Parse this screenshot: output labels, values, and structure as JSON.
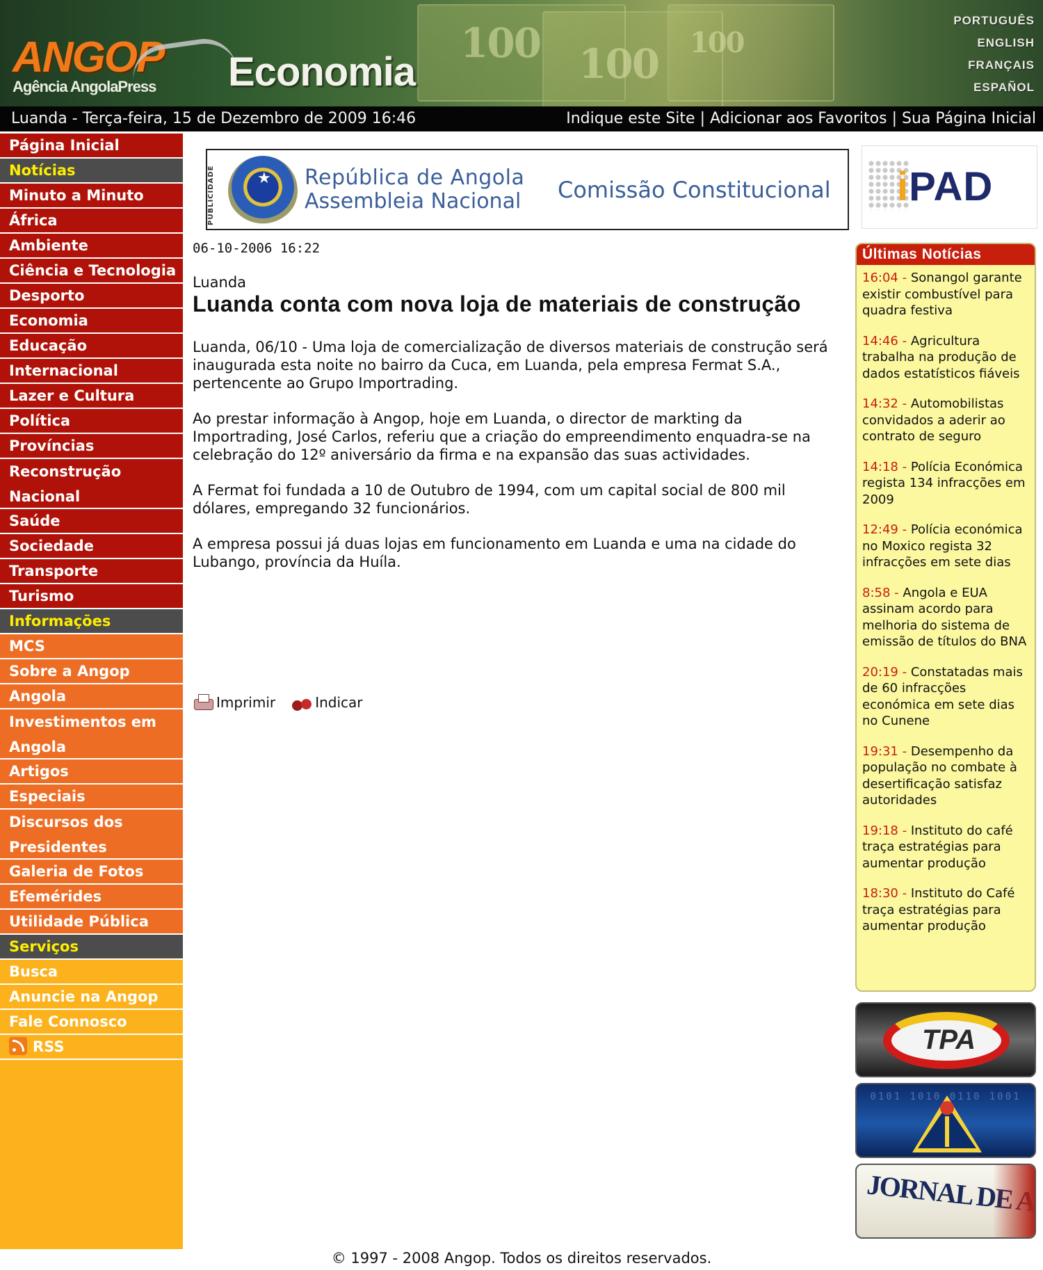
{
  "header": {
    "logo_text": "ANGOP",
    "logo_sub": "Agência AngolaPress",
    "section_title": "Economia",
    "banknote_values": [
      "100",
      "100",
      "100"
    ],
    "languages": [
      "PORTUGUÊS",
      "ENGLISH",
      "FRANÇAIS",
      "ESPAÑOL"
    ]
  },
  "topbar": {
    "date": "Luanda - Terça-feira, 15 de Dezembro de 2009 16:46",
    "links": [
      "Indique este Site",
      "Adicionar aos Favoritos",
      "Sua Página Inicial"
    ],
    "separator": "|"
  },
  "nav": {
    "home": "Página Inicial",
    "noticias_header": "Notícias",
    "noticias": [
      "Minuto a Minuto",
      "África",
      "Ambiente",
      "Ciência e Tecnologia",
      "Desporto",
      "Economia",
      "Educação",
      "Internacional",
      "Lazer e Cultura",
      "Política",
      "Províncias",
      "Reconstrução Nacional",
      "Saúde",
      "Sociedade",
      "Transporte",
      "Turismo"
    ],
    "informacoes_header": "Informações",
    "informacoes": [
      "MCS",
      "Sobre a Angop",
      "Angola",
      "Investimentos em Angola",
      "Artigos",
      "Especiais",
      "Discursos dos Presidentes",
      "Galeria de Fotos",
      "Efemérides",
      "Utilidade Pública"
    ],
    "servicos_header": "Serviços",
    "servicos": [
      "Busca",
      "Anuncie na Angop",
      "Fale Connosco",
      "RSS"
    ]
  },
  "banner": {
    "vertical_label": "PUBLICIDADE",
    "line1": "República de Angola",
    "line2": "Assembleia Nacional",
    "line3": "Comissão Constitucional"
  },
  "ipad_logo": {
    "i": "i",
    "rest": "PAD"
  },
  "article": {
    "datetime": "06-10-2006 16:22",
    "place": "Luanda",
    "title": "Luanda conta com nova loja de materiais de construção",
    "paragraphs": [
      "Luanda, 06/10 - Uma loja de comercialização de diversos materiais de construção será inaugurada esta noite no bairro da Cuca, em Luanda, pela empresa Fermat S.A., pertencente ao Grupo Importrading.",
      "Ao prestar informação à Angop, hoje em Luanda, o director de markting da Importrading, José Carlos, referiu que a criação do empreendimento enquadra-se na celebração do 12º aniversário da firma e na expansão das suas actividades.",
      "A Fermat foi fundada a 10 de Outubro de 1994, com um capital social de 800 mil dólares, empregando 32 funcionários.",
      "A empresa possui já duas lojas em funcionamento em Luanda e uma na cidade do Lubango, província da Huíla."
    ],
    "print_label": "Imprimir",
    "indicate_label": "Indicar"
  },
  "latest": {
    "title": "Últimas Notícias",
    "items": [
      {
        "time": "16:04",
        "text": "Sonangol garante existir combustível para quadra festiva"
      },
      {
        "time": "14:46",
        "text": "Agricultura trabalha na produção de dados estatísticos fiáveis"
      },
      {
        "time": "14:32",
        "text": "Automobilistas convidados a aderir ao contrato de seguro"
      },
      {
        "time": "14:18",
        "text": "Polícia Económica regista 134 infracções em 2009"
      },
      {
        "time": "12:49",
        "text": "Polícia económica no Moxico regista 32 infracções em sete dias"
      },
      {
        "time": "8:58",
        "text": "Angola e EUA assinam acordo para melhoria do sistema de emissão de títulos do BNA"
      },
      {
        "time": "20:19",
        "text": "Constatadas mais de 60 infracções económica em sete dias no Cunene"
      },
      {
        "time": "19:31",
        "text": "Desempenho da população no combate à desertificação satisfaz autoridades"
      },
      {
        "time": "19:18",
        "text": "Instituto do café traça estratégias para aumentar produção"
      },
      {
        "time": "18:30",
        "text": "Instituto do Café traça estratégias para aumentar produção"
      }
    ]
  },
  "media": {
    "tpa_text": "TPA",
    "rna_bits": "0101 1010 0110 1001",
    "ja_text": "JORNAL DE ANGOLA"
  },
  "footer": {
    "copyright": "© 1997 - 2008 Angop. Todos os direitos reservados."
  },
  "colors": {
    "nav_red": "#b01209",
    "nav_orange": "#ee6d24",
    "nav_yellow": "#fcb21c",
    "nav_section": "#4c4c4c",
    "section_text": "#ffee00",
    "news_bg": "#fbf8a0",
    "news_header": "#c81e0c"
  }
}
